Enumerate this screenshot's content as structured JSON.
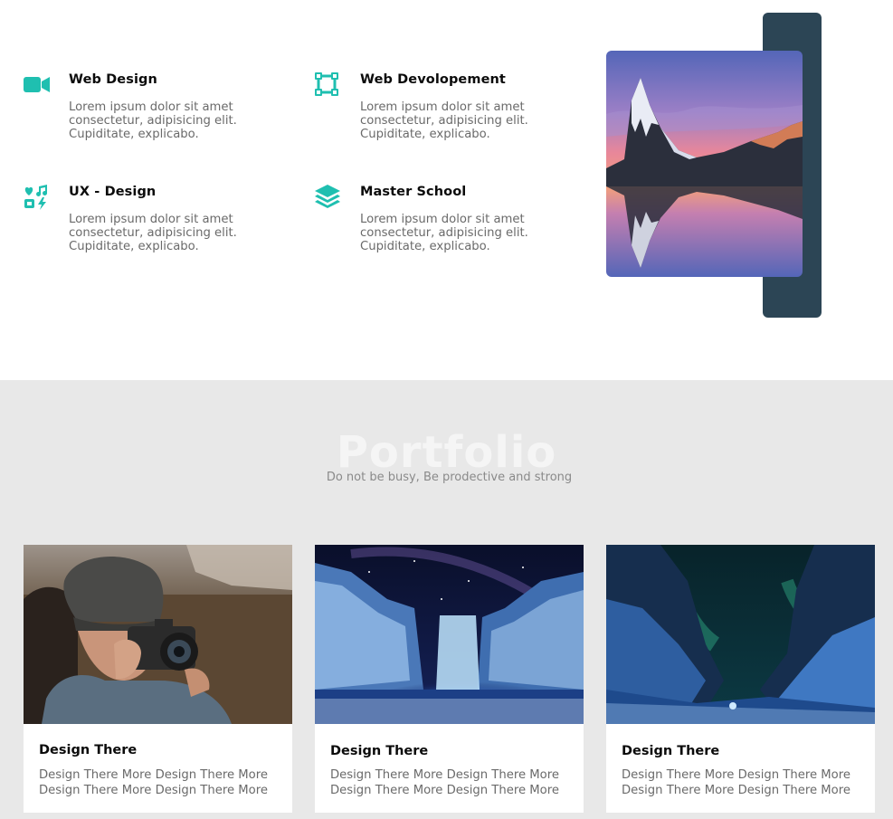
{
  "colors": {
    "accent": "#1fbfb0",
    "dark_panel": "#2c4555",
    "section_bg": "#e8e8e8",
    "heading_watermark": "#f5f5f5",
    "body_text": "#6a6a6a"
  },
  "services": {
    "items": [
      {
        "icon": "video-camera-icon",
        "title": "Web Design",
        "desc": [
          "Lorem ipsum dolor sit amet",
          "consectetur, adipisicing elit.",
          "Cupiditate, explicabo."
        ]
      },
      {
        "icon": "vector-square-icon",
        "title": "Web Devolopement",
        "desc": [
          "Lorem ipsum dolor sit amet",
          "consectetur, adipisicing elit.",
          "Cupiditate, explicabo."
        ]
      },
      {
        "icon": "icons-icon",
        "title": "UX - Design",
        "desc": [
          "Lorem ipsum dolor sit amet",
          "consectetur, adipisicing elit.",
          "Cupiditate, explicabo."
        ]
      },
      {
        "icon": "layer-group-icon",
        "title": "Master School",
        "desc": [
          "Lorem ipsum dolor sit amet",
          "consectetur, adipisicing elit.",
          "Cupiditate, explicabo."
        ]
      }
    ],
    "feature_image": "mountain-lake-sunset-photo"
  },
  "portfolio": {
    "heading": "Portfolio",
    "subtitle": "Do not be busy, Be prodective and strong",
    "cards": [
      {
        "image": "photographer-with-camera-photo",
        "title": "Design There",
        "desc": [
          "Design There More Design There More",
          "Design There More Design There More"
        ]
      },
      {
        "image": "waterfall-night-sky-photo",
        "title": "Design There",
        "desc": [
          "Design There More Design There More",
          "Design There More Design There More"
        ]
      },
      {
        "image": "aurora-canyon-photo",
        "title": "Design There",
        "desc": [
          "Design There More Design There More",
          "Design There More Design There More"
        ]
      }
    ]
  }
}
